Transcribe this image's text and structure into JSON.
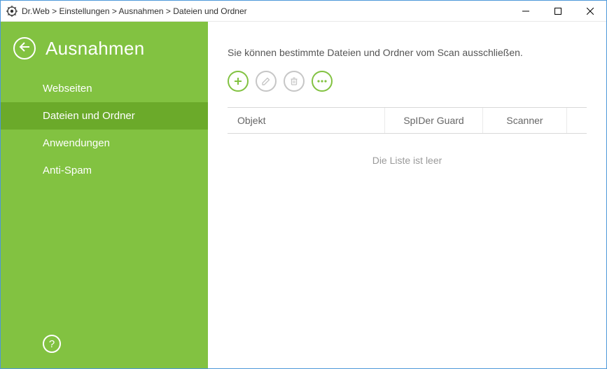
{
  "colors": {
    "accent_green": "#82c241",
    "accent_green_dark": "#6baa2a",
    "disabled_gray": "#c6c6c6"
  },
  "titlebar": {
    "breadcrumb_parts": [
      "Dr.Web",
      "Einstellungen",
      "Ausnahmen",
      "Dateien und Ordner"
    ],
    "breadcrumb_full": "Dr.Web > Einstellungen > Ausnahmen > Dateien und Ordner"
  },
  "sidebar": {
    "title": "Ausnahmen",
    "items": [
      {
        "label": "Webseiten",
        "active": false
      },
      {
        "label": "Dateien und Ordner",
        "active": true
      },
      {
        "label": "Anwendungen",
        "active": false
      },
      {
        "label": "Anti-Spam",
        "active": false
      }
    ],
    "help_label": "?"
  },
  "main": {
    "description": "Sie können bestimmte Dateien und Ordner vom Scan ausschließen.",
    "toolbar": {
      "add_icon": "plus",
      "edit_icon": "pencil",
      "delete_icon": "trash",
      "more_icon": "dots"
    },
    "table": {
      "columns": {
        "object": "Objekt",
        "spider_guard": "SpIDer Guard",
        "scanner": "Scanner"
      },
      "rows": [],
      "empty_text": "Die Liste ist leer"
    }
  }
}
